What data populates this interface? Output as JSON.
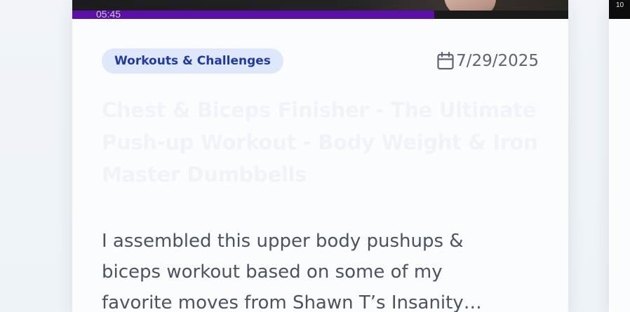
{
  "card": {
    "video": {
      "timestamp": "05:45",
      "progress_fraction": 0.73
    },
    "category": "Workouts & Challenges",
    "date": "7/29/2025",
    "title": "Chest & Biceps Finisher - The Ultimate Push-up Workout - Body Weight & Iron Master Dumbbells",
    "description": "I assembled this upper body pushups &\nbiceps workout based on some of my\nfavorite moves from Shawn T’s Insanity…"
  },
  "neighbor_card": {
    "video_timestamp": "10"
  },
  "icons": {
    "date": "calendar-icon"
  },
  "colors": {
    "badge_background": "#dfe7fb",
    "badge_text": "#1f3aa6",
    "progress": "#5b0ea8",
    "body_text": "#4b5262",
    "meta_text": "#5c6474"
  }
}
